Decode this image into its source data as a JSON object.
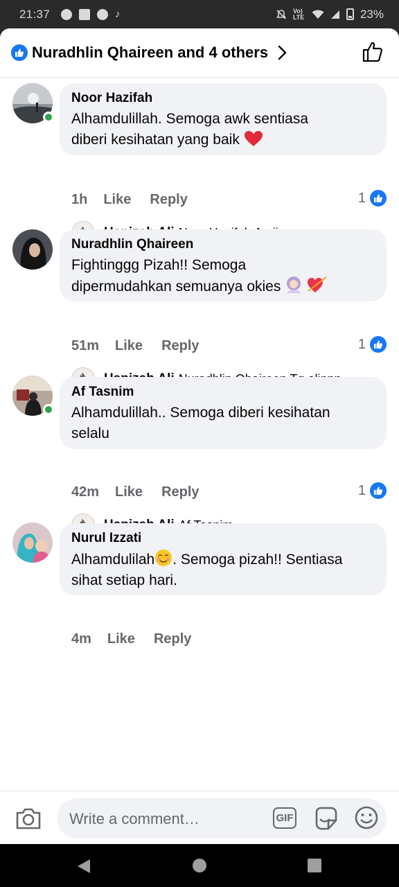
{
  "status_bar": {
    "time": "21:37",
    "network_label": "Vo) LTE",
    "battery": "23%"
  },
  "header": {
    "title": "Nuradhlin Qhaireen and 4 others"
  },
  "comments": [
    {
      "name": "Noor Hazifah",
      "text_line1": "Alhamdulillah. Semoga awk sentiasa",
      "text_line2": "diberi kesihatan yang baik",
      "time": "1h",
      "like_label": "Like",
      "reply_label": "Reply",
      "reaction_count": "1",
      "online": true,
      "reply": {
        "name": "Hapizah Ali",
        "text": "Noor Hazifah Amiinn"
      }
    },
    {
      "name": "Nuradhlin Qhaireen",
      "text_line1": "Fightinggg Pizah!! Semoga",
      "text_line2": "dipermudahkan semuanya okies",
      "time": "51m",
      "like_label": "Like",
      "reply_label": "Reply",
      "reaction_count": "1",
      "online": false,
      "reply": {
        "name": "Hapizah Ali",
        "text": "Nuradhlin Qhaireen Tq alinnn"
      }
    },
    {
      "name": "Af Tasnim",
      "text_line1": "Alhamdulillah.. Semoga diberi kesihatan",
      "text_line2": "selalu",
      "time": "42m",
      "like_label": "Like",
      "reply_label": "Reply",
      "reaction_count": "1",
      "online": true,
      "reply": {
        "name": "Hapizah Ali",
        "text": "Af Tasnim"
      }
    },
    {
      "name": "Nurul Izzati",
      "text_line1": "Alhamdulilah",
      "text_line1_after": ". Semoga pizah!! Sentiasa",
      "text_line2": "sihat setiap hari.",
      "time": "4m",
      "like_label": "Like",
      "reply_label": "Reply",
      "online": false
    }
  ],
  "composer": {
    "placeholder": "Write a comment…",
    "gif_label": "GIF"
  },
  "colors": {
    "accent": "#1877f2",
    "bubble": "#f0f2f5",
    "secondary_text": "#65676b",
    "online": "#31a24c"
  }
}
